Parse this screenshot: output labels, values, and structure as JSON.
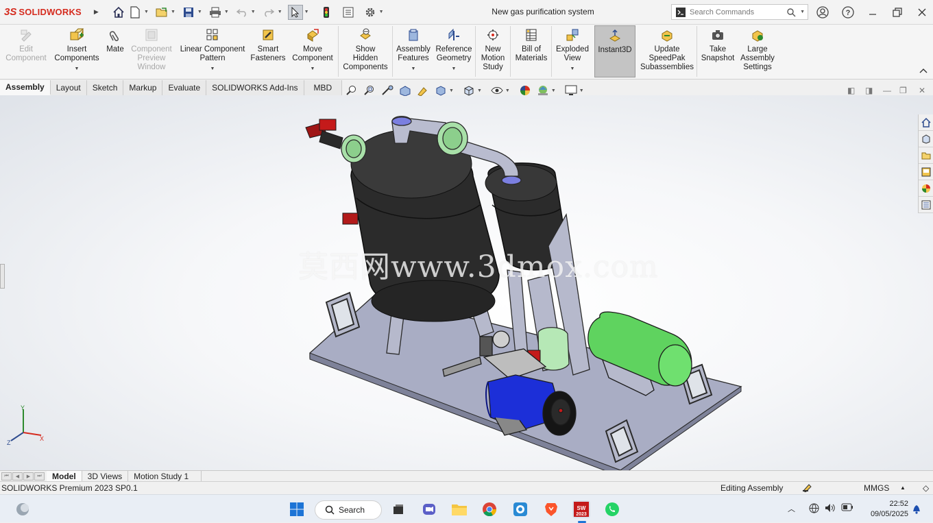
{
  "app": {
    "brand_ds": "3S",
    "brand_name": "SOLIDWORKS",
    "window_title": "New gas purification system",
    "search_placeholder": "Search Commands"
  },
  "ribbon": {
    "buttons": [
      {
        "label1": "Edit",
        "label2": "Component",
        "label3": "",
        "disabled": true
      },
      {
        "label1": "Insert",
        "label2": "Components",
        "label3": "",
        "disabled": false
      },
      {
        "label1": "Mate",
        "label2": "",
        "label3": "",
        "disabled": false
      },
      {
        "label1": "Component",
        "label2": "Preview",
        "label3": "Window",
        "disabled": true
      },
      {
        "label1": "Linear Component",
        "label2": "Pattern",
        "label3": "",
        "disabled": false
      },
      {
        "label1": "Smart",
        "label2": "Fasteners",
        "label3": "",
        "disabled": false
      },
      {
        "label1": "Move",
        "label2": "Component",
        "label3": "",
        "disabled": false
      },
      {
        "label1": "Show",
        "label2": "Hidden",
        "label3": "Components",
        "disabled": false
      },
      {
        "label1": "Assembly",
        "label2": "Features",
        "label3": "",
        "disabled": false
      },
      {
        "label1": "Reference",
        "label2": "Geometry",
        "label3": "",
        "disabled": false
      },
      {
        "label1": "New",
        "label2": "Motion",
        "label3": "Study",
        "disabled": false
      },
      {
        "label1": "Bill of",
        "label2": "Materials",
        "label3": "",
        "disabled": false
      },
      {
        "label1": "Exploded",
        "label2": "View",
        "label3": "",
        "disabled": false
      },
      {
        "label1": "Instant3D",
        "label2": "",
        "label3": "",
        "disabled": false
      },
      {
        "label1": "Update",
        "label2": "SpeedPak",
        "label3": "Subassemblies",
        "disabled": false
      },
      {
        "label1": "Take",
        "label2": "Snapshot",
        "label3": "",
        "disabled": false
      },
      {
        "label1": "Large",
        "label2": "Assembly",
        "label3": "Settings",
        "disabled": false
      }
    ]
  },
  "command_tabs": [
    "Assembly",
    "Layout",
    "Sketch",
    "Markup",
    "Evaluate",
    "SOLIDWORKS Add-Ins",
    "MBD"
  ],
  "viewport": {
    "watermark": "莫西网www.3dmox.com",
    "triad": {
      "x": "X",
      "y": "Y",
      "z": "Z"
    }
  },
  "bottom_tabs": [
    "Model",
    "3D Views",
    "Motion Study 1"
  ],
  "status": {
    "product": "SOLIDWORKS Premium 2023 SP0.1",
    "mode": "Editing Assembly",
    "units": "MMGS"
  },
  "taskbar": {
    "search_label": "Search",
    "sw_badge": "2023",
    "time": "22:52",
    "date": "09/05/2025"
  },
  "colors": {
    "accent_red": "#d52b1e",
    "tank_dark": "#2b2b2b",
    "green_tank": "#5fd35f",
    "motor_blue": "#1c2fd8",
    "plate": "#a9adc4"
  }
}
